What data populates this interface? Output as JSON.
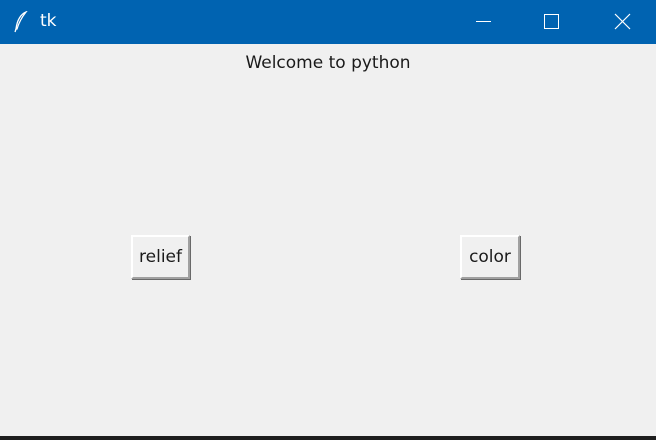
{
  "window": {
    "title": "tk",
    "app_icon": "feather-icon",
    "controls": {
      "minimize_icon": "minimize-icon",
      "maximize_icon": "maximize-icon",
      "close_icon": "close-icon"
    },
    "titlebar_color": "#0063b1",
    "background_color": "#f0f0f0"
  },
  "main": {
    "label_text": "Welcome to python",
    "buttons": {
      "relief_label": "relief",
      "color_label": "color"
    }
  }
}
